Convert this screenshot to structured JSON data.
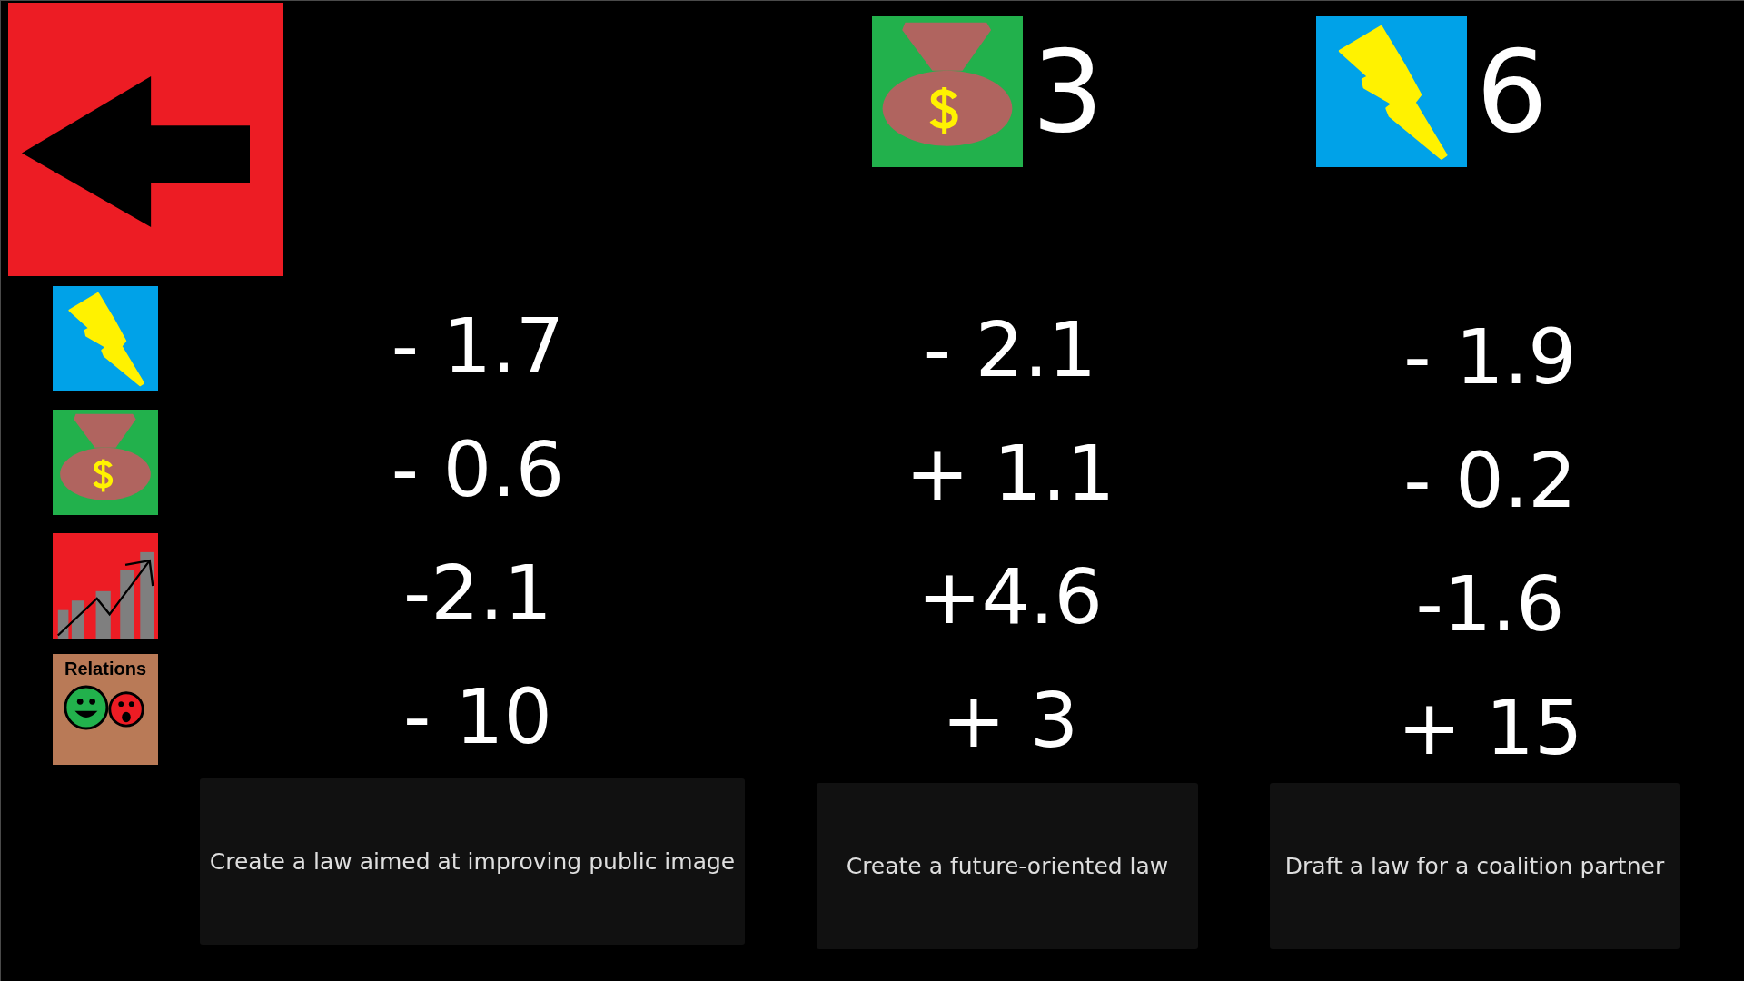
{
  "resources": [
    {
      "kind": "money",
      "amount": "3"
    },
    {
      "kind": "energy",
      "amount": "6"
    }
  ],
  "effect_rows": [
    {
      "kind": "energy"
    },
    {
      "kind": "money"
    },
    {
      "kind": "growth"
    },
    {
      "kind": "relations",
      "label": "Relations"
    }
  ],
  "options": [
    {
      "effects": [
        "- 1.7",
        "- 0.6",
        "-2.1",
        "- 10"
      ],
      "button": "Create a law aimed at improving public image"
    },
    {
      "effects": [
        "- 2.1",
        "+ 1.1",
        "+4.6",
        "+ 3"
      ],
      "button": "Create a future-oriented law"
    },
    {
      "effects": [
        "- 1.9",
        "- 0.2",
        "-1.6",
        "+ 15"
      ],
      "button": "Draft a law for a coalition partner"
    }
  ]
}
